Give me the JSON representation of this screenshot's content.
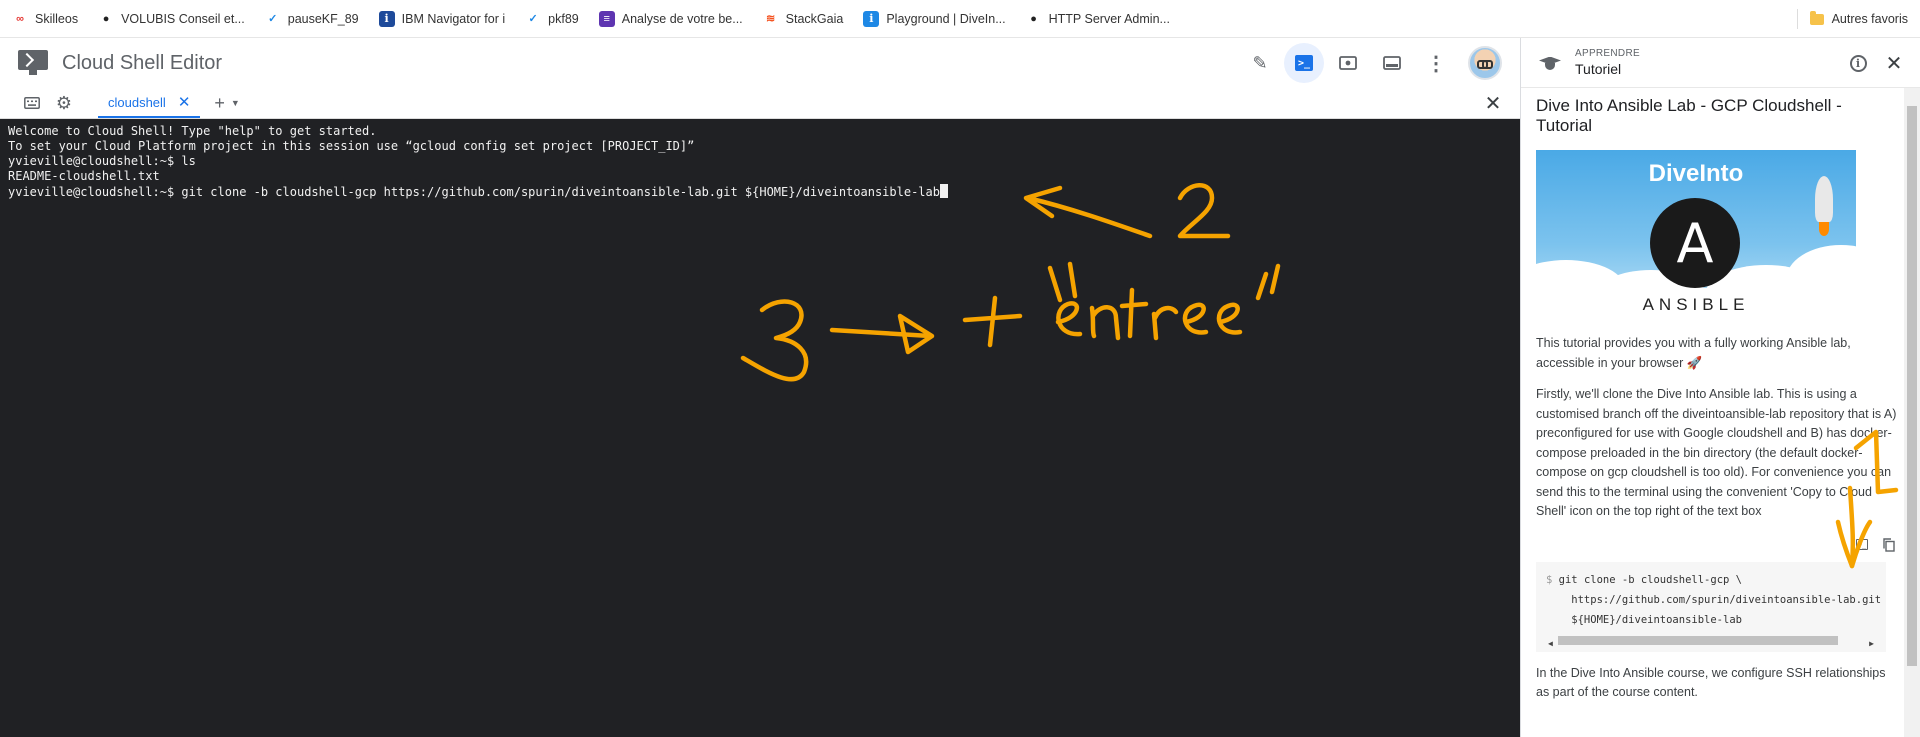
{
  "bookmarks": [
    {
      "label": "Skilleos",
      "icon": "infinity-icon",
      "color": "#e53935"
    },
    {
      "label": "VOLUBIS Conseil et...",
      "icon": "globe-icon",
      "color": "#222222"
    },
    {
      "label": "pauseKF_89",
      "icon": "checkmark-icon",
      "color": "#1e88e5"
    },
    {
      "label": "IBM Navigator for i",
      "icon": "info-icon",
      "color": "#1e4a9a"
    },
    {
      "label": "pkf89",
      "icon": "checkmark-icon",
      "color": "#1e88e5"
    },
    {
      "label": "Analyse de votre be...",
      "icon": "list-icon",
      "color": "#5e35b1"
    },
    {
      "label": "StackGaia",
      "icon": "stack-icon",
      "color": "#f4511e"
    },
    {
      "label": "Playground | DiveIn...",
      "icon": "info-icon",
      "color": "#1e88e5"
    },
    {
      "label": "HTTP Server Admin...",
      "icon": "globe-icon",
      "color": "#222222"
    }
  ],
  "bookmarks_other": "Autres favoris",
  "editor": {
    "title": "Cloud Shell Editor",
    "tab_label": "cloudshell"
  },
  "terminal": {
    "lines": [
      "Welcome to Cloud Shell! Type \"help\" to get started.",
      "To set your Cloud Platform project in this session use “gcloud config set project [PROJECT_ID]”",
      "yvieville@cloudshell:~$ ls",
      "README-cloudshell.txt",
      "yvieville@cloudshell:~$ git clone -b cloudshell-gcp https://github.com/spurin/diveintoansible-lab.git ${HOME}/diveintoansible-lab"
    ]
  },
  "annotations": {
    "step2": "2",
    "step3": "3",
    "plus": "+",
    "entree": "\"entree\"",
    "step1": "1",
    "color": "#f5a300"
  },
  "tutorial": {
    "kicker": "APPRENDRE",
    "header_title": "Tutoriel",
    "doc_title": "Dive Into Ansible Lab - GCP Cloudshell - Tutorial",
    "hero_brand": "DiveInto",
    "hero_word": "ANSIBLE",
    "hero_letter": "A",
    "intro": "This tutorial provides you with a fully working Ansible lab, accessible in your browser 🚀",
    "step_text": "Firstly, we'll clone the Dive Into Ansible lab. This is using a customised branch off the diveintoansible-lab repository that is A) preconfigured for use with Google cloudshell and B) has docker-compose preloaded in the bin directory (the default docker-compose on gcp cloudshell is too old). For convenience you can send this to the terminal using the convenient 'Copy to Cloud Shell' icon on the top right of the text box",
    "code_prompt": "$",
    "code_lines": [
      "git clone -b cloudshell-gcp \\",
      "    https://github.com/spurin/diveintoansible-lab.git \\",
      "    ${HOME}/diveintoansible-lab"
    ],
    "after_text": "In the Dive Into Ansible course, we configure SSH relationships as part of the course content."
  }
}
